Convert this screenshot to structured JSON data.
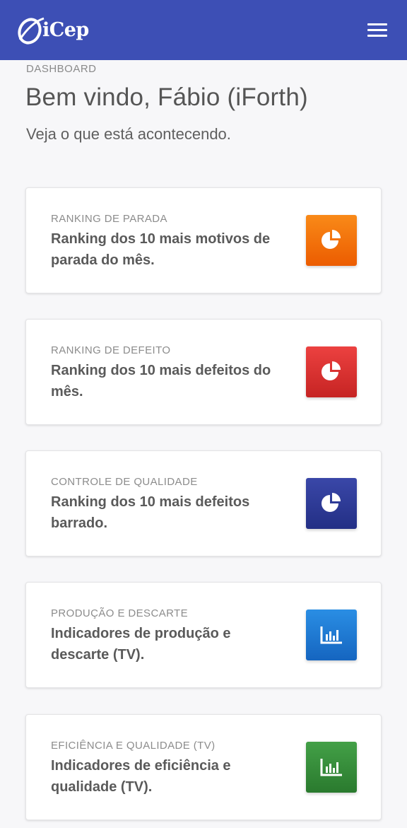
{
  "header": {
    "logo_text": "iCep",
    "menu_icon": "hamburger-menu-icon"
  },
  "page": {
    "breadcrumb": "DASHBOARD",
    "title": "Bem vindo, Fábio (iForth)",
    "subtitle": "Veja o que está acontecendo."
  },
  "cards": [
    {
      "category": "RANKING DE PARADA",
      "description": "Ranking dos 10 mais motivos de parada do mês.",
      "icon": "pie-chart-icon",
      "color_top": "#f98a18",
      "color_bottom": "#ec5c00"
    },
    {
      "category": "RANKING DE DEFEITO",
      "description": "Ranking dos 10 mais defeitos do mês.",
      "icon": "pie-chart-icon",
      "color_top": "#ec4140",
      "color_bottom": "#c62423"
    },
    {
      "category": "CONTROLE DE QUALIDADE",
      "description": "Ranking dos 10 mais defeitos barrado.",
      "icon": "pie-chart-icon",
      "color_top": "#3a47a8",
      "color_bottom": "#232f85"
    },
    {
      "category": "PRODUÇÃO E DESCARTE",
      "description": "Indicadores de produção e descarte (TV).",
      "icon": "bar-chart-icon",
      "color_top": "#2a8ee4",
      "color_bottom": "#1565c0"
    },
    {
      "category": "EFICIÊNCIA E QUALIDADE (TV)",
      "description": "Indicadores de eficiência e qualidade (TV).",
      "icon": "bar-chart-icon",
      "color_top": "#43a047",
      "color_bottom": "#2a7a2e"
    }
  ]
}
